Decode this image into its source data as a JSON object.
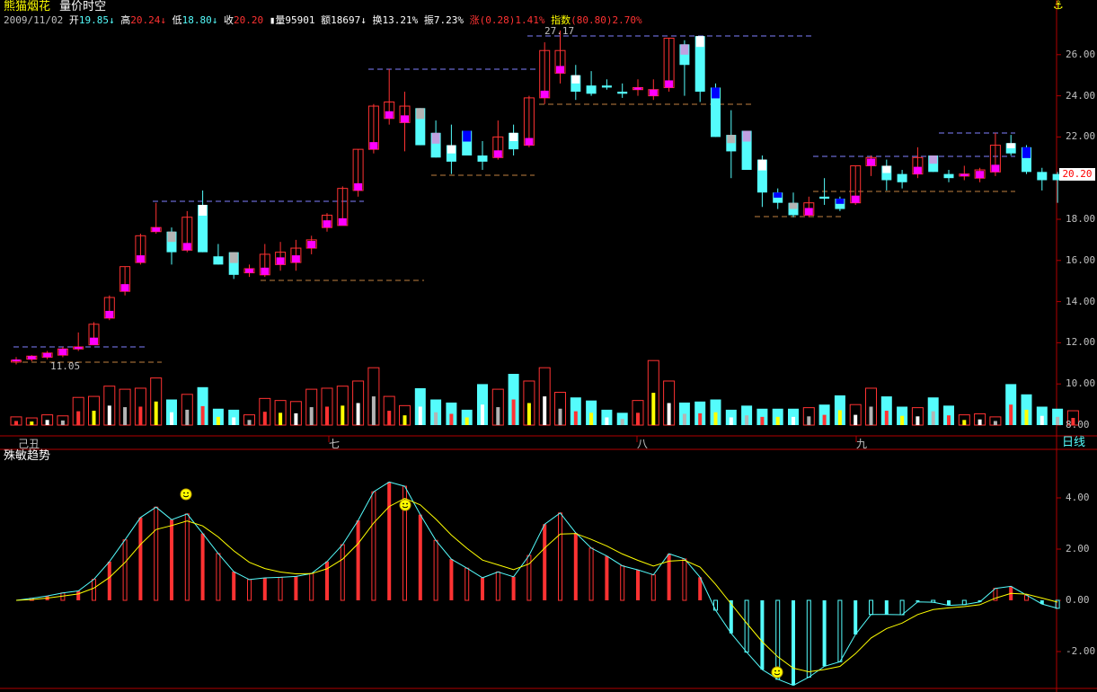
{
  "header": {
    "stock_name": "熊猫烟花",
    "view_name": "量价时空",
    "date": "2009/11/02",
    "open_label": "开",
    "open": "19.85",
    "high_label": "高",
    "high": "20.24",
    "low_label": "低",
    "low": "18.80",
    "close_label": "收",
    "close": "20.20",
    "vol_label": "量",
    "vol": "95901",
    "amount_label": "额",
    "amount": "18697",
    "turnover_label": "换",
    "turnover": "13.21%",
    "amp_label": "振",
    "amp": "7.23%",
    "change_label": "涨",
    "change": "(0.28)1.41%",
    "index_label": "指数",
    "index": "(80.80)2.70%",
    "anchor_icon": "anchor-icon"
  },
  "price_axis": {
    "ticks": [
      "26.00",
      "24.00",
      "22.00",
      "20.00",
      "18.00",
      "16.00",
      "14.00",
      "12.00",
      "10.00",
      "8.00"
    ]
  },
  "current_price_tag": "20.20",
  "annotations": {
    "max_price": "27.17",
    "min_price": "11.05"
  },
  "time_axis": {
    "labels": [
      "己丑",
      "七",
      "八",
      "九"
    ],
    "period_button": "日线"
  },
  "indicator": {
    "name": "殊敏趋势",
    "ticks": [
      "4.00",
      "2.00",
      "0.00",
      "-2.00"
    ]
  },
  "colors": {
    "up": "#ff3232",
    "down": "#54fcfc",
    "magenta": "#ff00ff",
    "yellow": "#ffff00",
    "white": "#ffffff",
    "blue": "#0000ff",
    "grey": "#b4b4b4",
    "lavender": "#c0a0e0",
    "axis": "#b00000",
    "ma_line": "#ffff00",
    "trend_line": "#54fcfc"
  },
  "chart_data": {
    "type": "candlestick",
    "candles": [
      {
        "o": 11.1,
        "h": 11.3,
        "l": 10.95,
        "c": 11.15
      },
      {
        "o": 11.2,
        "h": 11.4,
        "l": 11.1,
        "c": 11.35
      },
      {
        "o": 11.3,
        "h": 11.6,
        "l": 11.2,
        "c": 11.5
      },
      {
        "o": 11.4,
        "h": 11.8,
        "l": 11.3,
        "c": 11.7
      },
      {
        "o": 11.7,
        "h": 12.5,
        "l": 11.6,
        "c": 11.8
      },
      {
        "o": 11.9,
        "h": 13.0,
        "l": 11.9,
        "c": 12.9
      },
      {
        "o": 13.2,
        "h": 14.3,
        "l": 13.1,
        "c": 14.2
      },
      {
        "o": 14.5,
        "h": 15.7,
        "l": 14.3,
        "c": 15.7
      },
      {
        "o": 15.9,
        "h": 17.3,
        "l": 15.8,
        "c": 17.2
      },
      {
        "o": 17.4,
        "h": 18.8,
        "l": 17.3,
        "c": 17.6
      },
      {
        "o": 17.4,
        "h": 17.6,
        "l": 15.8,
        "c": 16.4
      },
      {
        "o": 16.5,
        "h": 18.4,
        "l": 16.4,
        "c": 18.1
      },
      {
        "o": 18.7,
        "h": 19.4,
        "l": 16.4,
        "c": 16.4
      },
      {
        "o": 16.2,
        "h": 16.8,
        "l": 15.8,
        "c": 15.8
      },
      {
        "o": 16.4,
        "h": 16.4,
        "l": 15.1,
        "c": 15.3
      },
      {
        "o": 15.4,
        "h": 15.8,
        "l": 15.2,
        "c": 15.6
      },
      {
        "o": 15.3,
        "h": 16.8,
        "l": 15.2,
        "c": 16.3
      },
      {
        "o": 15.8,
        "h": 16.9,
        "l": 15.5,
        "c": 16.4
      },
      {
        "o": 15.9,
        "h": 17.0,
        "l": 15.5,
        "c": 16.6
      },
      {
        "o": 16.6,
        "h": 17.2,
        "l": 16.3,
        "c": 17.0
      },
      {
        "o": 17.6,
        "h": 18.3,
        "l": 17.4,
        "c": 18.2
      },
      {
        "o": 17.7,
        "h": 19.6,
        "l": 17.7,
        "c": 19.5
      },
      {
        "o": 19.4,
        "h": 21.4,
        "l": 19.1,
        "c": 21.4
      },
      {
        "o": 21.4,
        "h": 23.6,
        "l": 21.2,
        "c": 23.5
      },
      {
        "o": 22.9,
        "h": 25.3,
        "l": 22.6,
        "c": 23.7
      },
      {
        "o": 22.7,
        "h": 24.2,
        "l": 21.3,
        "c": 23.5
      },
      {
        "o": 23.4,
        "h": 23.4,
        "l": 21.6,
        "c": 21.6
      },
      {
        "o": 22.2,
        "h": 22.8,
        "l": 21.0,
        "c": 21.0
      },
      {
        "o": 21.6,
        "h": 22.6,
        "l": 20.2,
        "c": 20.8
      },
      {
        "o": 22.3,
        "h": 22.3,
        "l": 21.1,
        "c": 21.1
      },
      {
        "o": 21.1,
        "h": 21.8,
        "l": 20.4,
        "c": 20.8
      },
      {
        "o": 21.0,
        "h": 22.8,
        "l": 20.9,
        "c": 22.0
      },
      {
        "o": 22.2,
        "h": 22.6,
        "l": 21.1,
        "c": 21.4
      },
      {
        "o": 21.6,
        "h": 24.0,
        "l": 21.5,
        "c": 23.9
      },
      {
        "o": 23.9,
        "h": 26.6,
        "l": 23.6,
        "c": 26.2
      },
      {
        "o": 25.1,
        "h": 27.17,
        "l": 24.6,
        "c": 26.2
      },
      {
        "o": 25.0,
        "h": 25.5,
        "l": 23.8,
        "c": 24.2
      },
      {
        "o": 24.5,
        "h": 25.2,
        "l": 24.0,
        "c": 24.1
      },
      {
        "o": 24.5,
        "h": 24.8,
        "l": 24.3,
        "c": 24.4
      },
      {
        "o": 24.2,
        "h": 24.6,
        "l": 23.9,
        "c": 24.1
      },
      {
        "o": 24.3,
        "h": 24.8,
        "l": 24.0,
        "c": 24.4
      },
      {
        "o": 24.0,
        "h": 24.8,
        "l": 23.8,
        "c": 24.3
      },
      {
        "o": 24.4,
        "h": 26.8,
        "l": 24.2,
        "c": 26.8
      },
      {
        "o": 26.5,
        "h": 26.7,
        "l": 24.0,
        "c": 25.5
      },
      {
        "o": 26.9,
        "h": 26.9,
        "l": 23.7,
        "c": 24.2
      },
      {
        "o": 24.4,
        "h": 24.6,
        "l": 22.0,
        "c": 22.0
      },
      {
        "o": 22.1,
        "h": 23.3,
        "l": 20.0,
        "c": 21.3
      },
      {
        "o": 22.3,
        "h": 22.3,
        "l": 20.5,
        "c": 20.4
      },
      {
        "o": 20.9,
        "h": 21.1,
        "l": 18.6,
        "c": 19.3
      },
      {
        "o": 19.3,
        "h": 19.5,
        "l": 18.5,
        "c": 18.8
      },
      {
        "o": 18.8,
        "h": 19.3,
        "l": 18.1,
        "c": 18.2
      },
      {
        "o": 18.2,
        "h": 19.1,
        "l": 18.1,
        "c": 18.8
      },
      {
        "o": 19.1,
        "h": 20.0,
        "l": 18.7,
        "c": 19.0
      },
      {
        "o": 19.0,
        "h": 19.1,
        "l": 18.4,
        "c": 18.5
      },
      {
        "o": 18.8,
        "h": 20.6,
        "l": 18.7,
        "c": 20.6
      },
      {
        "o": 20.6,
        "h": 21.1,
        "l": 20.1,
        "c": 21.0
      },
      {
        "o": 20.6,
        "h": 20.9,
        "l": 19.4,
        "c": 19.9
      },
      {
        "o": 20.2,
        "h": 20.4,
        "l": 19.5,
        "c": 19.8
      },
      {
        "o": 20.2,
        "h": 21.5,
        "l": 20.0,
        "c": 21.0
      },
      {
        "o": 21.1,
        "h": 21.1,
        "l": 20.3,
        "c": 20.3
      },
      {
        "o": 20.2,
        "h": 20.4,
        "l": 19.8,
        "c": 20.0
      },
      {
        "o": 20.1,
        "h": 20.6,
        "l": 19.9,
        "c": 20.2
      },
      {
        "o": 20.0,
        "h": 20.5,
        "l": 19.8,
        "c": 20.4
      },
      {
        "o": 20.3,
        "h": 22.2,
        "l": 20.1,
        "c": 21.6
      },
      {
        "o": 21.7,
        "h": 22.1,
        "l": 21.1,
        "c": 21.2
      },
      {
        "o": 21.5,
        "h": 21.6,
        "l": 20.2,
        "c": 20.3
      },
      {
        "o": 20.3,
        "h": 20.5,
        "l": 19.4,
        "c": 19.9
      },
      {
        "o": 20.2,
        "h": 20.3,
        "l": 18.8,
        "c": 19.9
      }
    ],
    "volumes": [
      0.8,
      0.7,
      1.0,
      0.9,
      2.7,
      2.8,
      3.8,
      3.5,
      3.6,
      4.6,
      2.5,
      3.0,
      3.7,
      1.6,
      1.5,
      1.0,
      2.6,
      2.4,
      2.3,
      3.5,
      3.6,
      3.8,
      4.3,
      5.6,
      2.8,
      1.9,
      3.6,
      2.5,
      2.2,
      1.5,
      4.0,
      3.5,
      5.0,
      4.3,
      5.6,
      3.2,
      2.7,
      2.4,
      1.5,
      1.2,
      2.4,
      6.3,
      4.3,
      2.2,
      2.3,
      2.5,
      1.5,
      1.9,
      1.6,
      1.6,
      1.6,
      1.7,
      2.0,
      2.9,
      2.0,
      3.6,
      2.8,
      1.8,
      1.7,
      2.7,
      1.9,
      1.0,
      1.1,
      0.8,
      4.0,
      3.0,
      1.8,
      1.6,
      1.4
    ]
  }
}
